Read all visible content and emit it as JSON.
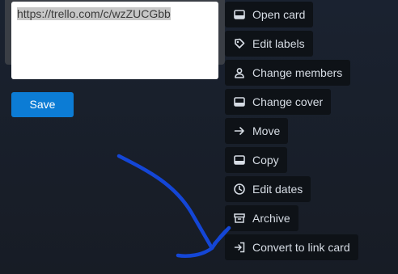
{
  "editor": {
    "url_value": "https://trello.com/c/wzZUCGbb"
  },
  "save_label": "Save",
  "menu": {
    "items": [
      {
        "label": "Open card",
        "icon": "card-icon"
      },
      {
        "label": "Edit labels",
        "icon": "tag-icon"
      },
      {
        "label": "Change members",
        "icon": "person-icon"
      },
      {
        "label": "Change cover",
        "icon": "cover-icon"
      },
      {
        "label": "Move",
        "icon": "arrow-right-icon"
      },
      {
        "label": "Copy",
        "icon": "card-icon"
      },
      {
        "label": "Edit dates",
        "icon": "clock-icon"
      },
      {
        "label": "Archive",
        "icon": "archive-icon"
      },
      {
        "label": "Convert to link card",
        "icon": "link-card-icon"
      }
    ]
  },
  "colors": {
    "background": "#171c25",
    "save_button": "#0c7cd5",
    "menu_button": "#0e1217",
    "menu_text": "#d7dde5",
    "annotation_stroke": "#1446d6"
  }
}
